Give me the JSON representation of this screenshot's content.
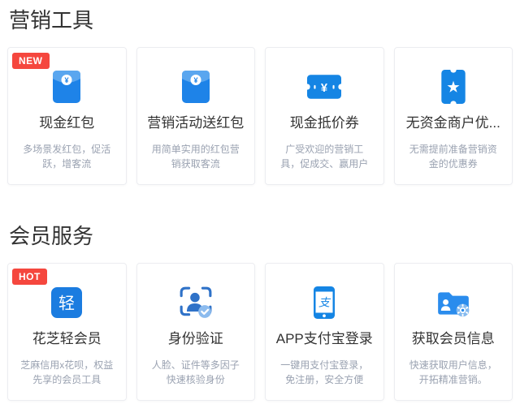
{
  "colors": {
    "accent_blue": "#1585e4",
    "badge_red": "#f5473e",
    "title_text": "#333333",
    "desc_text": "#9aa2b1"
  },
  "sections": [
    {
      "title": "营销工具",
      "cards": [
        {
          "badge": "NEW",
          "icon": "red-packet-icon",
          "title": "现金红包",
          "desc": "多场景发红包，促活跃，增客流"
        },
        {
          "icon": "red-packet-icon",
          "title": "营销活动送红包",
          "desc": "用简单实用的红包营销获取客流"
        },
        {
          "icon": "cash-coupon-icon",
          "title": "现金抵价券",
          "desc": "广受欢迎的营销工具，促成交、赢用户"
        },
        {
          "icon": "merchant-coupon-icon",
          "title": "无资金商户优...",
          "desc": "无需提前准备营销资金的优惠券"
        }
      ]
    },
    {
      "title": "会员服务",
      "cards": [
        {
          "badge": "HOT",
          "icon": "qing-member-icon",
          "title": "花芝轻会员",
          "desc": "芝麻信用x花呗，权益先享的会员工具"
        },
        {
          "icon": "identity-verify-icon",
          "title": "身份验证",
          "desc": "人脸、证件等多因子快速核验身份"
        },
        {
          "icon": "alipay-phone-icon",
          "title": "APP支付宝登录",
          "desc": "一键用支付宝登录，免注册，安全方便"
        },
        {
          "icon": "member-info-icon",
          "title": "获取会员信息",
          "desc": "快速获取用户信息，开拓精准营销。"
        }
      ]
    }
  ]
}
